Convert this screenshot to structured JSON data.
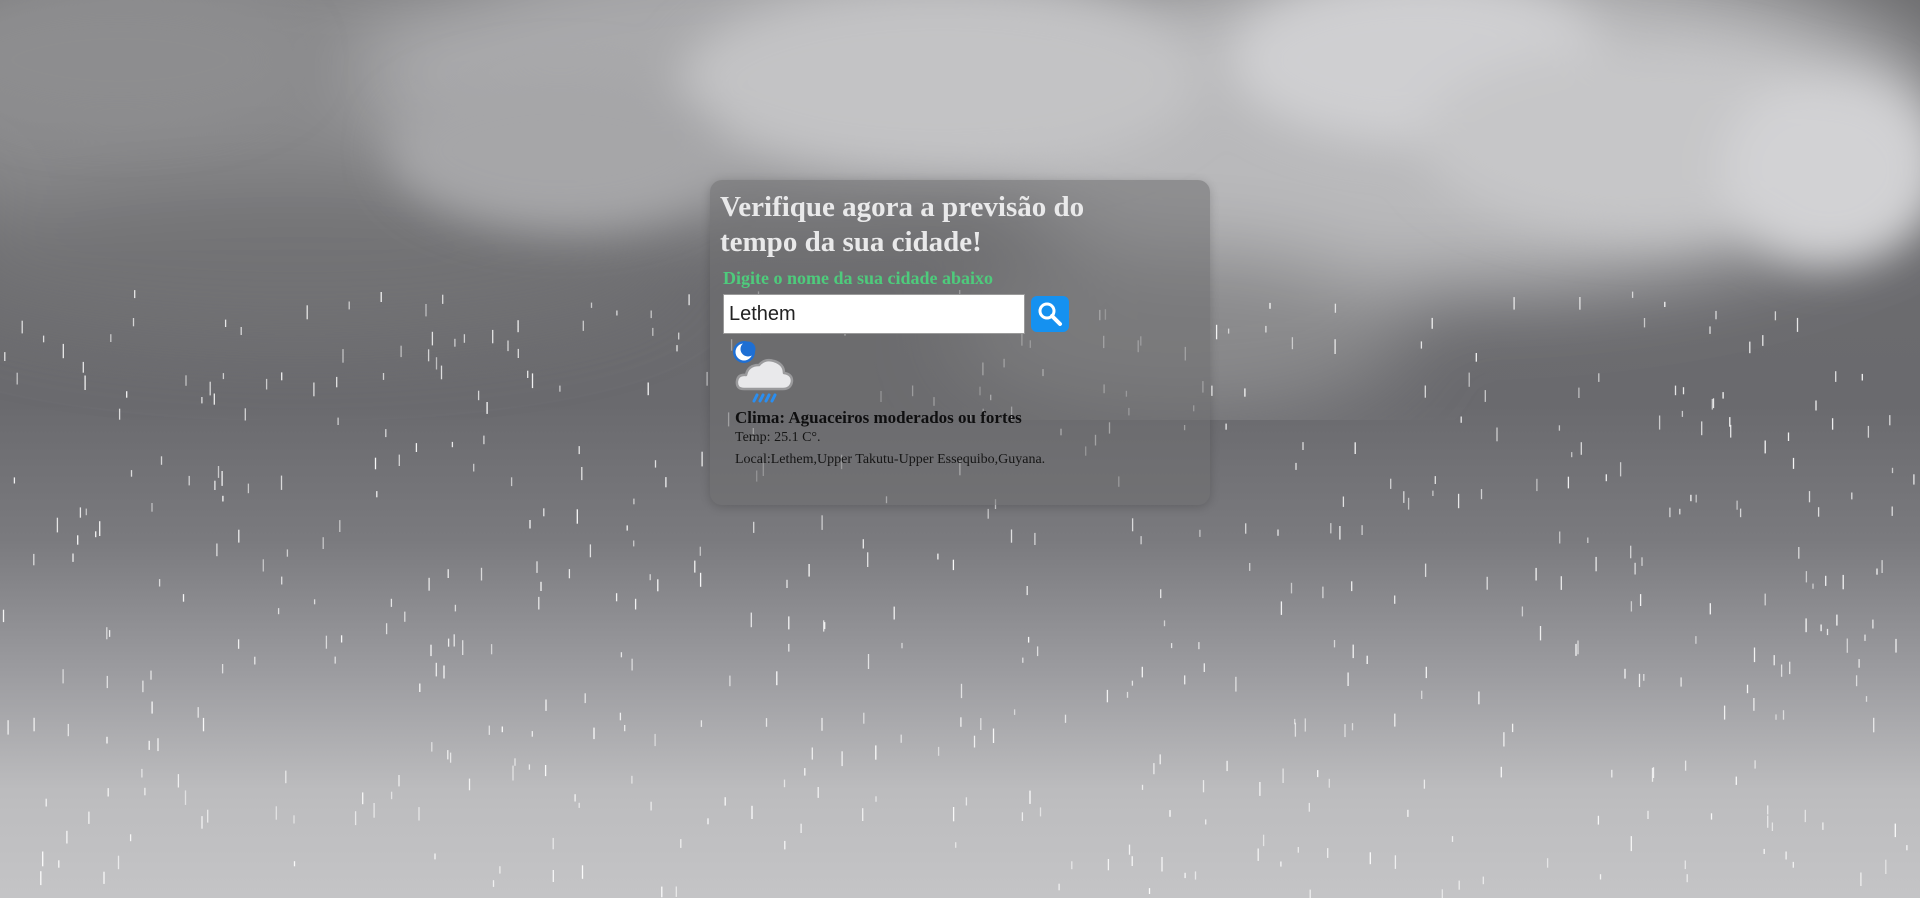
{
  "header": {
    "title": "Verifique agora a previsão do tempo da sua cidade!",
    "subtitle": "Digite o nome da sua cidade abaixo"
  },
  "search": {
    "value": "Lethem",
    "button_icon": "search-icon"
  },
  "weather": {
    "icon": "night-rain-showers-icon",
    "condition": "Clima: Aguaceiros moderados ou fortes",
    "temperature": "Temp: 25.1 C°.",
    "location": "Local:Lethem,Upper Takutu-Upper Essequibo,Guyana."
  },
  "colors": {
    "subtitle": "#4ecb7c",
    "search_button": "#1591f0",
    "title": "#e9e9ea",
    "rain_drop": "#4a9ff0"
  }
}
